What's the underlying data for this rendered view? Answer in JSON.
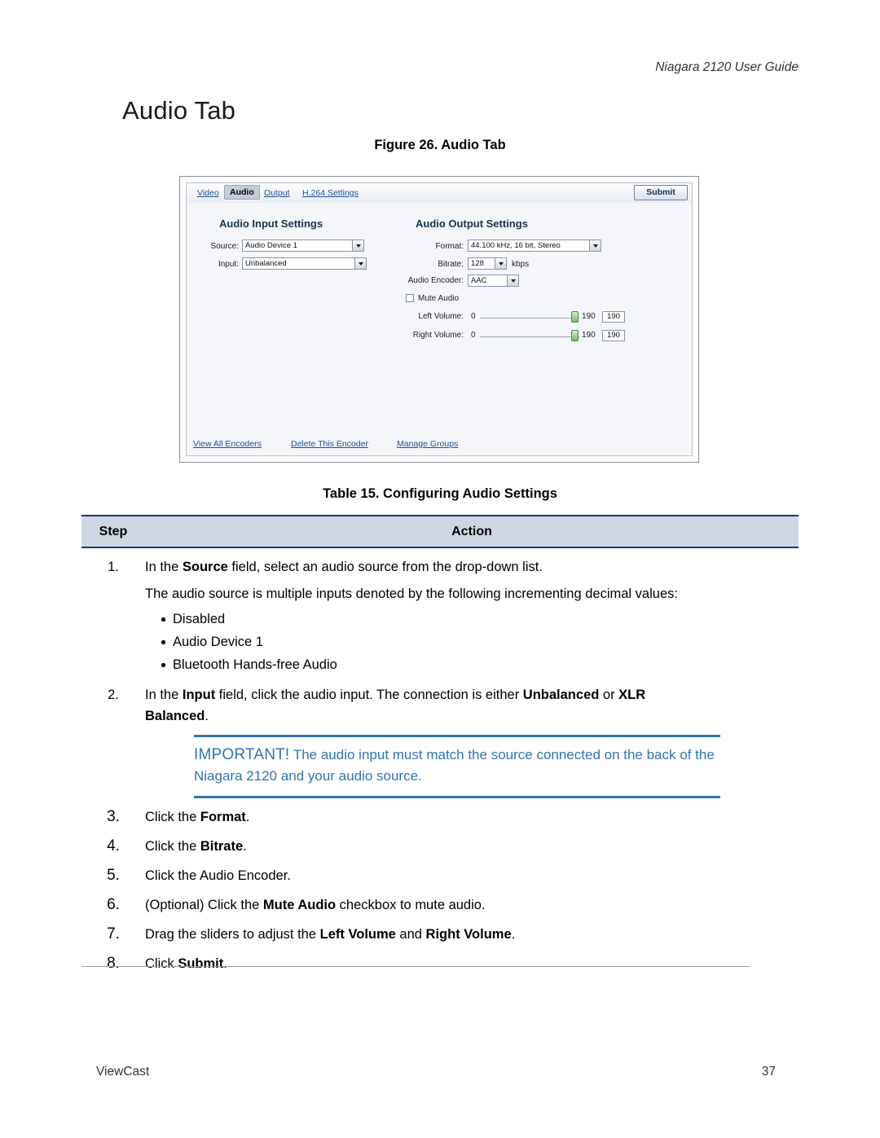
{
  "header": {
    "running_head": "Niagara 2120 User Guide",
    "page_title": "Audio Tab"
  },
  "figure": {
    "caption": "Figure 26. Audio Tab",
    "tabs": [
      {
        "label": "Video",
        "active": false
      },
      {
        "label": "Audio",
        "active": true
      },
      {
        "label": "Output",
        "active": false
      },
      {
        "label": "H.264 Settings",
        "active": false
      }
    ],
    "submit_label": "Submit",
    "input_settings": {
      "title": "Audio Input Settings",
      "source_label": "Source:",
      "source_value": "Audio Device 1",
      "input_label": "Input:",
      "input_value": "Unbalanced"
    },
    "output_settings": {
      "title": "Audio Output Settings",
      "format_label": "Format:",
      "format_value": "44.100 kHz, 16 bit, Stereo",
      "bitrate_label": "Bitrate:",
      "bitrate_value": "128",
      "bitrate_unit": "kbps",
      "encoder_label": "Audio Encoder:",
      "encoder_value": "AAC",
      "mute_label": "Mute Audio",
      "mute_checked": false,
      "left_label": "Left Volume:",
      "left_min": "0",
      "left_value": "190",
      "left_box": "190",
      "right_label": "Right Volume:",
      "right_min": "0",
      "right_value": "190",
      "right_box": "190"
    },
    "footer_links": [
      "View All Encoders",
      "Delete This Encoder",
      "Manage Groups"
    ]
  },
  "table": {
    "caption": "Table 15. Configuring Audio Settings",
    "headers": {
      "step": "Step",
      "action": "Action"
    },
    "rows": [
      {
        "step": "1.",
        "action_html": "In the <b>Source</b> field, select an audio source from the drop-down list.",
        "sub_html": "The audio source is multiple inputs denoted by the following incrementing decimal values:",
        "bullets": [
          "Disabled",
          "Audio Device 1",
          "Bluetooth Hands-free Audio"
        ]
      },
      {
        "step": "2.",
        "action_html": "In the <b>Input</b> field, click the audio input. The connection is either <b>Unbalanced</b> or <b>XLR Balanced</b>."
      },
      {
        "step": "3.",
        "action_html": "Click the <b>Format</b>."
      },
      {
        "step": "4.",
        "action_html": "Click the <b>Bitrate</b>."
      },
      {
        "step": "5.",
        "action_html": "Click the Audio Encoder."
      },
      {
        "step": "6.",
        "action_html": "(Optional) Click the <b>Mute Audio</b> checkbox to mute audio."
      },
      {
        "step": "7.",
        "action_html": "Drag the sliders to adjust the <b>Left Volume</b> and <b>Right Volume</b>."
      },
      {
        "step": "8.",
        "action_html": "Click <b>Submit</b>."
      }
    ],
    "important": {
      "keyword": "IMPORTANT!",
      "text": " The audio input must match the source connected on the back of the Niagara 2120 and your audio source."
    }
  },
  "footer": {
    "company": "ViewCast",
    "page_number": "37"
  }
}
